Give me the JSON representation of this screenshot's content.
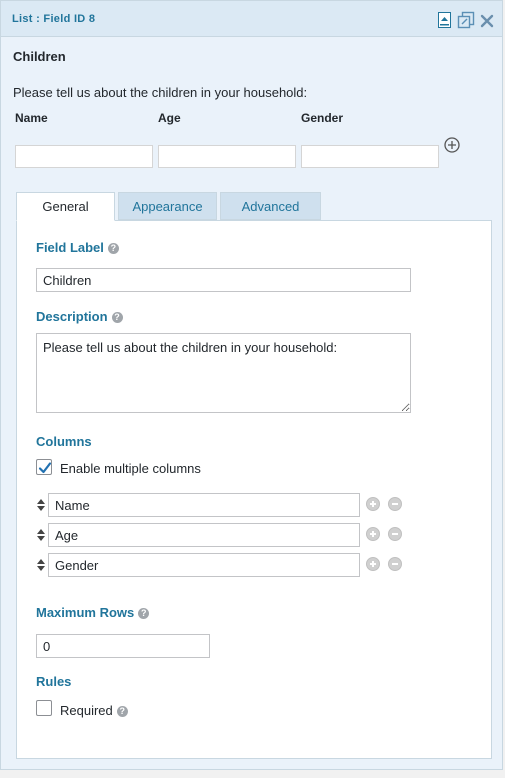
{
  "header": {
    "title": "List : Field ID 8"
  },
  "icons": {
    "collapse": "collapse-up-icon",
    "duplicate": "duplicate-icon",
    "delete": "close-icon"
  },
  "preview": {
    "field_label": "Children",
    "description": "Please tell us about the children in your household:",
    "columns": [
      "Name",
      "Age",
      "Gender"
    ]
  },
  "tabs": [
    {
      "label": "General",
      "active": true
    },
    {
      "label": "Appearance",
      "active": false
    },
    {
      "label": "Advanced",
      "active": false
    }
  ],
  "settings": {
    "field_label": {
      "label": "Field Label",
      "value": "Children"
    },
    "description": {
      "label": "Description",
      "value": "Please tell us about the children in your household:"
    },
    "columns": {
      "label": "Columns",
      "enable_multiple_label": "Enable multiple columns",
      "enable_multiple_checked": true,
      "items": [
        "Name",
        "Age",
        "Gender"
      ]
    },
    "maximum_rows": {
      "label": "Maximum Rows",
      "value": "0"
    },
    "rules": {
      "label": "Rules",
      "required_label": "Required",
      "required_checked": false
    }
  },
  "colors": {
    "accent": "#21759b",
    "panel_bg": "#eaf2fa",
    "titlebar_bg": "#dbe9f4",
    "border": "#c8d7e1"
  }
}
